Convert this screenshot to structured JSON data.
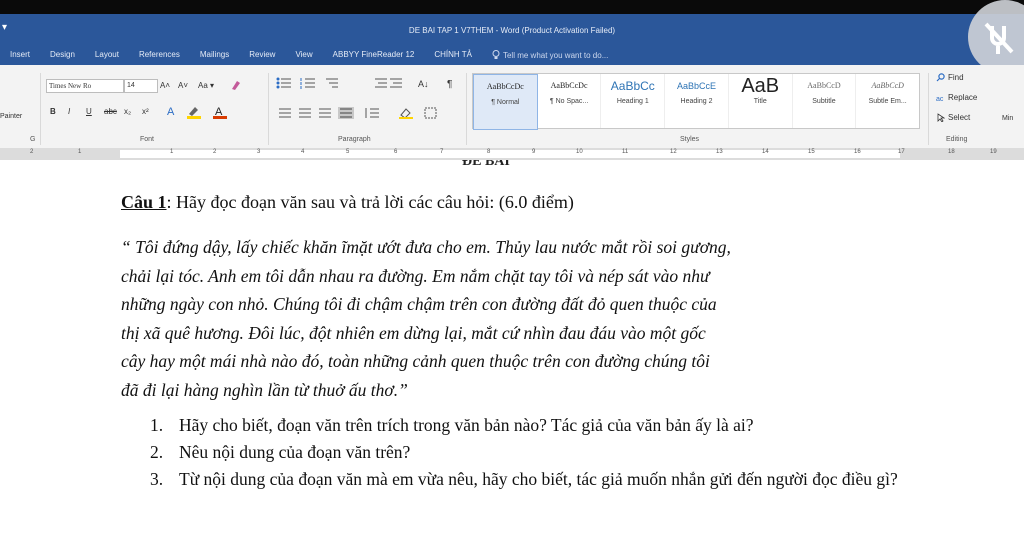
{
  "window": {
    "title": "DE BAI TAP 1 V7THEM - Word (Product Activation Failed)",
    "qat_glyph": "▾"
  },
  "tabs": [
    "Insert",
    "Design",
    "Layout",
    "References",
    "Mailings",
    "Review",
    "View",
    "ABBYY FineReader 12",
    "CHÍNH TẢ"
  ],
  "tell_me": "Tell me what you want to do...",
  "clipboard": {
    "painter": "Painter",
    "label": "G"
  },
  "font": {
    "name": "Times New Ro",
    "size": "14",
    "grow": "A˄",
    "shrink": "A˅",
    "case": "Aa ▾",
    "bold": "B",
    "italic": "I",
    "underline": "U",
    "strike": "abc",
    "subscript": "x₂",
    "superscript": "x²",
    "group_label": "Font"
  },
  "paragraph": {
    "group_label": "Paragraph"
  },
  "styles": {
    "group_label": "Styles",
    "items": [
      {
        "preview": "AaBbCcDc",
        "name": "¶ Normal"
      },
      {
        "preview": "AaBbCcDc",
        "name": "¶ No Spac..."
      },
      {
        "preview": "AaBbCc",
        "name": "Heading 1"
      },
      {
        "preview": "AaBbCcE",
        "name": "Heading 2"
      },
      {
        "preview": "AaB",
        "name": "Title"
      },
      {
        "preview": "AaBbCcD",
        "name": "Subtitle"
      },
      {
        "preview": "AaBbCcD",
        "name": "Subtle Em..."
      }
    ]
  },
  "editing": {
    "find": "Find",
    "replace": "Replace",
    "select": "Select",
    "group_label": "Editing",
    "overflow": "Min"
  },
  "ruler": {
    "numbers": [
      "2",
      "1",
      "1",
      "2",
      "3",
      "4",
      "5",
      "6",
      "7",
      "8",
      "9",
      "10",
      "11",
      "12",
      "13",
      "14",
      "15",
      "16",
      "17",
      "18",
      "19"
    ]
  },
  "document": {
    "cut_heading": "ĐỀ BÀI",
    "question1_label": "Câu 1",
    "question1_text": ": Hãy đọc đoạn văn sau và trả lời các câu hỏi: (6.0 điểm)",
    "passage_lines": [
      "“ Tôi đứng dậy, lấy chiếc khăn ĩmặt ướt đưa cho em. Thủy lau nước mắt rồi soi gương,",
      "chải lại tóc. Anh em tôi dẫn nhau ra đường. Em nắm chặt tay tôi và nép sát vào như",
      "những ngày con nhỏ. Chúng tôi đi chậm chậm trên con đường đất đỏ quen thuộc của",
      "thị xã quê hương. Đôi lúc, đột nhiên em dừng lại, mắt cứ nhìn đau đáu vào một gốc",
      "cây hay một mái nhà nào đó, toàn những cảnh quen thuộc trên con đường chúng tôi",
      "đã đi lại hàng nghìn lần từ thuở ấu thơ.”"
    ],
    "questions": [
      {
        "num": "1.",
        "text": "Hãy cho biết, đoạn văn trên trích trong văn bản nào? Tác giả của văn bản ấy là ai?"
      },
      {
        "num": "2.",
        "text": "Nêu nội dung của đoạn văn trên?"
      },
      {
        "num": "3.",
        "text": "Từ nội dung của đoạn văn mà em vừa nêu, hãy cho biết, tác giả muốn nhắn gửi đến người đọc điều gì?"
      }
    ]
  },
  "colors": {
    "ribbon_blue": "#2b579a",
    "ribbon_gray": "#f3f3f3",
    "ruler_gray": "#dcdcdc",
    "highlight_yellow": "#ffd400",
    "font_red": "#d83b01"
  },
  "icons": [
    "format-painter-icon",
    "bullets-icon",
    "numbering-icon",
    "multilevel-icon",
    "indent-icon",
    "sort-icon",
    "pilcrow-icon",
    "align-icon",
    "shading-icon",
    "border-icon",
    "find-icon",
    "replace-icon",
    "select-icon",
    "lightbulb-icon",
    "hidden-mic-icon"
  ]
}
